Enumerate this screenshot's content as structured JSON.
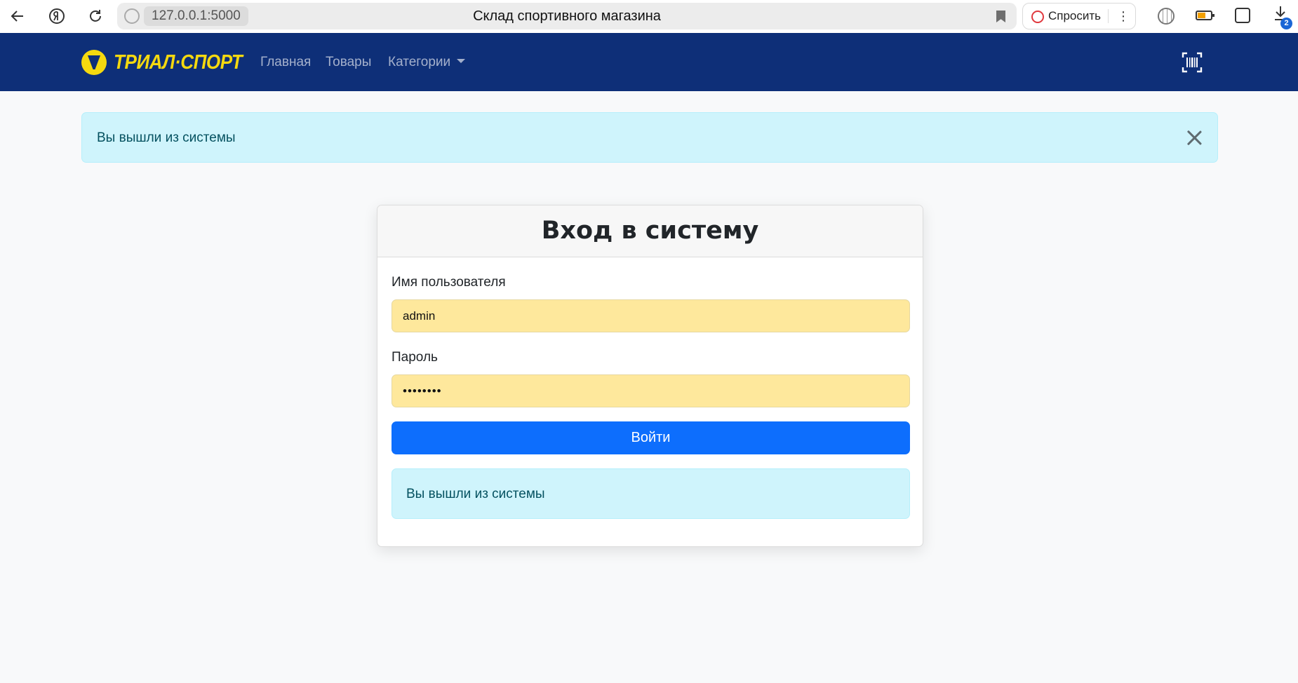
{
  "browser": {
    "url": "127.0.0.1:5000",
    "tab_title": "Склад спортивного магазина",
    "ask_label": "Спросить",
    "more_label": "⋮",
    "downloads_badge": "2",
    "icons": [
      "back-icon",
      "yandex-icon",
      "reload-icon",
      "site-icon",
      "bookmark-icon",
      "ask-icon",
      "globe-icon",
      "battery-icon",
      "collections-icon",
      "downloads-icon"
    ]
  },
  "navbar": {
    "brand": "ТРИАЛ·СПОРТ",
    "links": {
      "home": "Главная",
      "products": "Товары",
      "categories": "Категории"
    },
    "colors": {
      "background": "#0e2f78",
      "brand": "#f5d90f"
    }
  },
  "top_alert": {
    "text": "Вы вышли из системы"
  },
  "login": {
    "title": "Вход в систему",
    "username_label": "Имя пользователя",
    "username_value": "admin",
    "password_label": "Пароль",
    "password_value": "••••••••",
    "submit_label": "Войти",
    "message": "Вы вышли из системы",
    "colors": {
      "button": "#0d6efd",
      "autofill": "#fee89c",
      "alert_bg": "#cff4fc"
    }
  }
}
